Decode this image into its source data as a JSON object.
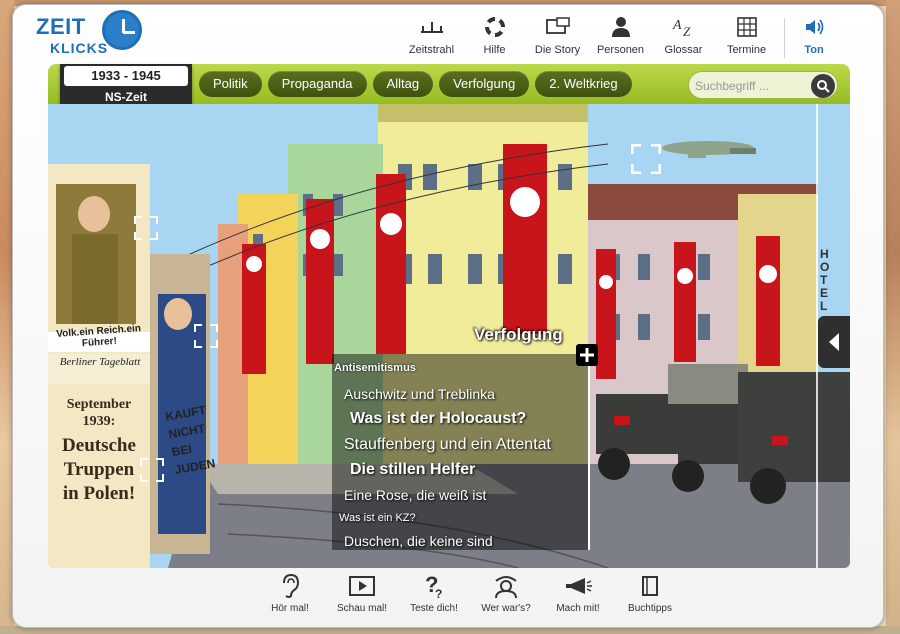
{
  "logo": {
    "line1": "ZEIT",
    "line2": "KLICKS"
  },
  "topnav": [
    {
      "label": "Zeitstrahl",
      "icon": "timeline-icon"
    },
    {
      "label": "Hilfe",
      "icon": "lifebuoy-icon"
    },
    {
      "label": "Die Story",
      "icon": "story-icon"
    },
    {
      "label": "Personen",
      "icon": "person-icon"
    },
    {
      "label": "Glossar",
      "icon": "glossary-icon"
    },
    {
      "label": "Termine",
      "icon": "calendar-icon"
    },
    {
      "label": "Ton",
      "icon": "speaker-icon"
    }
  ],
  "era": {
    "years": "1933 - 1945",
    "name": "NS-Zeit"
  },
  "tabs": [
    "Politik",
    "Propaganda",
    "Alltag",
    "Verfolgung",
    "2. Weltkrieg"
  ],
  "search": {
    "placeholder": "Suchbegriff ..."
  },
  "scene": {
    "section_title": "Verfolgung",
    "category": "Antisemitismus",
    "links": [
      "Auschwitz und Treblinka",
      "Was ist der Holocaust?",
      "Stauffenberg und ein Attentat",
      "Die stillen Helfer",
      "Eine Rose, die weiß ist",
      "Was ist ein KZ?",
      "Duschen, die keine sind"
    ],
    "poster_text": "Volk.ein Reich.ein Führer!",
    "newspaper": "Berliner Tageblatt",
    "headline": [
      "September",
      "1939:",
      "Deutsche",
      "Truppen",
      "in Polen!"
    ],
    "graffiti": [
      "KAUFT",
      "NICHT",
      "BEI",
      "JUDEN"
    ],
    "hotel_sign": "HOTEL"
  },
  "bottomnav": [
    {
      "label": "Hör mal!",
      "icon": "ear-icon"
    },
    {
      "label": "Schau mal!",
      "icon": "play-icon"
    },
    {
      "label": "Teste dich!",
      "icon": "question-icon"
    },
    {
      "label": "Wer war's?",
      "icon": "detective-icon"
    },
    {
      "label": "Mach mit!",
      "icon": "megaphone-icon"
    },
    {
      "label": "Buchtipps",
      "icon": "book-icon"
    }
  ],
  "colors": {
    "accent_green": "#a6c935",
    "brand_blue": "#1e6fb8",
    "flag_red": "#c8141b"
  }
}
